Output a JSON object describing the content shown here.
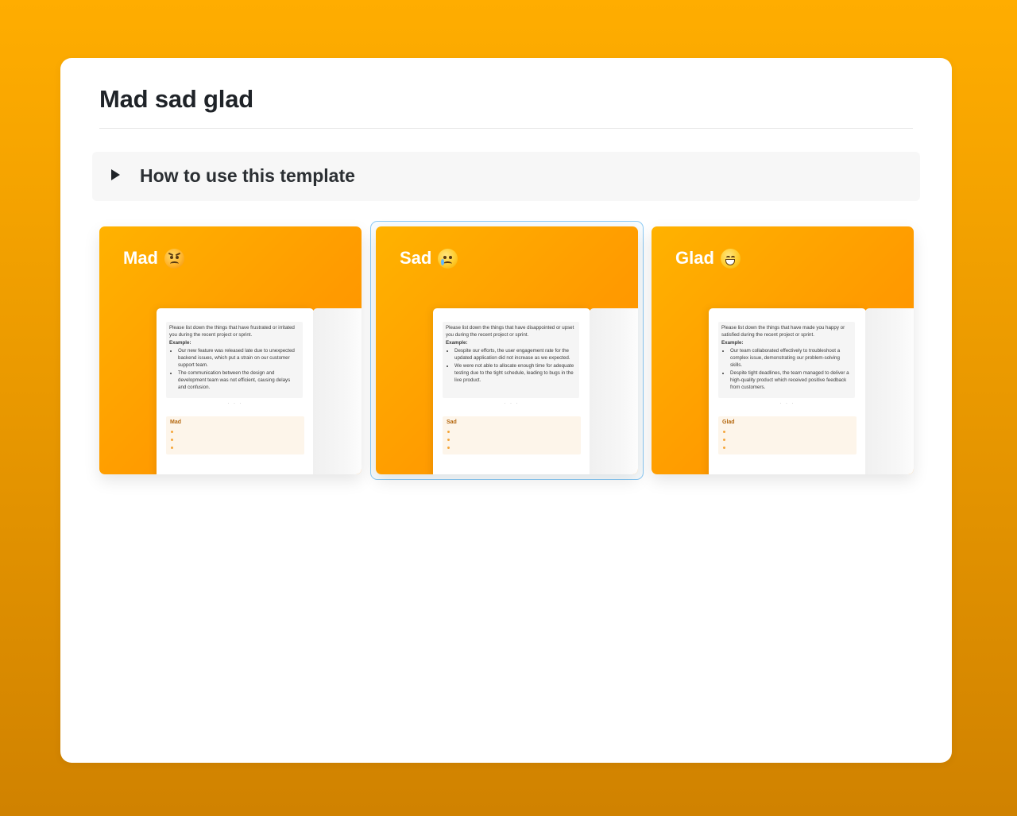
{
  "page": {
    "title": "Mad sad glad",
    "toggle_label": "How to use this template"
  },
  "colors": {
    "background": "#ffad00",
    "card_gradient_start": "#ffb200",
    "card_gradient_end": "#ff8f00",
    "selection_border": "#8ccaf5",
    "section_title": "#b4670e"
  },
  "cards": [
    {
      "label": "Mad",
      "emoji_icon": "angry-face-icon",
      "prompt": "Please list down the things that have frustrated or irritated you during the recent project or sprint.",
      "example_label": "Example:",
      "examples": [
        "Our new feature was released late due to unexpected backend issues, which put a strain on our customer support team.",
        "The communication between the design and development team was not efficient, causing delays and confusion."
      ],
      "dots": "· · ·",
      "section_title": "Mad",
      "selected": false
    },
    {
      "label": "Sad",
      "emoji_icon": "crying-face-icon",
      "prompt": "Please list down the things that have disappointed or upset you during the recent project or sprint.",
      "example_label": "Example:",
      "examples": [
        "Despite our efforts, the user engagement rate for the updated application did not increase as we expected.",
        "We were not able to allocate enough time for adequate testing due to the tight schedule, leading to bugs in the live product."
      ],
      "dots": "· · ·",
      "section_title": "Sad",
      "selected": true
    },
    {
      "label": "Glad",
      "emoji_icon": "grinning-face-icon",
      "prompt": "Please list down the things that have made you happy or satisfied during the recent project or sprint.",
      "example_label": "Example:",
      "examples": [
        "Our team collaborated effectively to troubleshoot a complex issue, demonstrating our problem-solving skills.",
        "Despite tight deadlines, the team managed to deliver a high-quality product which received positive feedback from customers."
      ],
      "dots": "· · ·",
      "section_title": "Glad",
      "selected": false
    }
  ]
}
